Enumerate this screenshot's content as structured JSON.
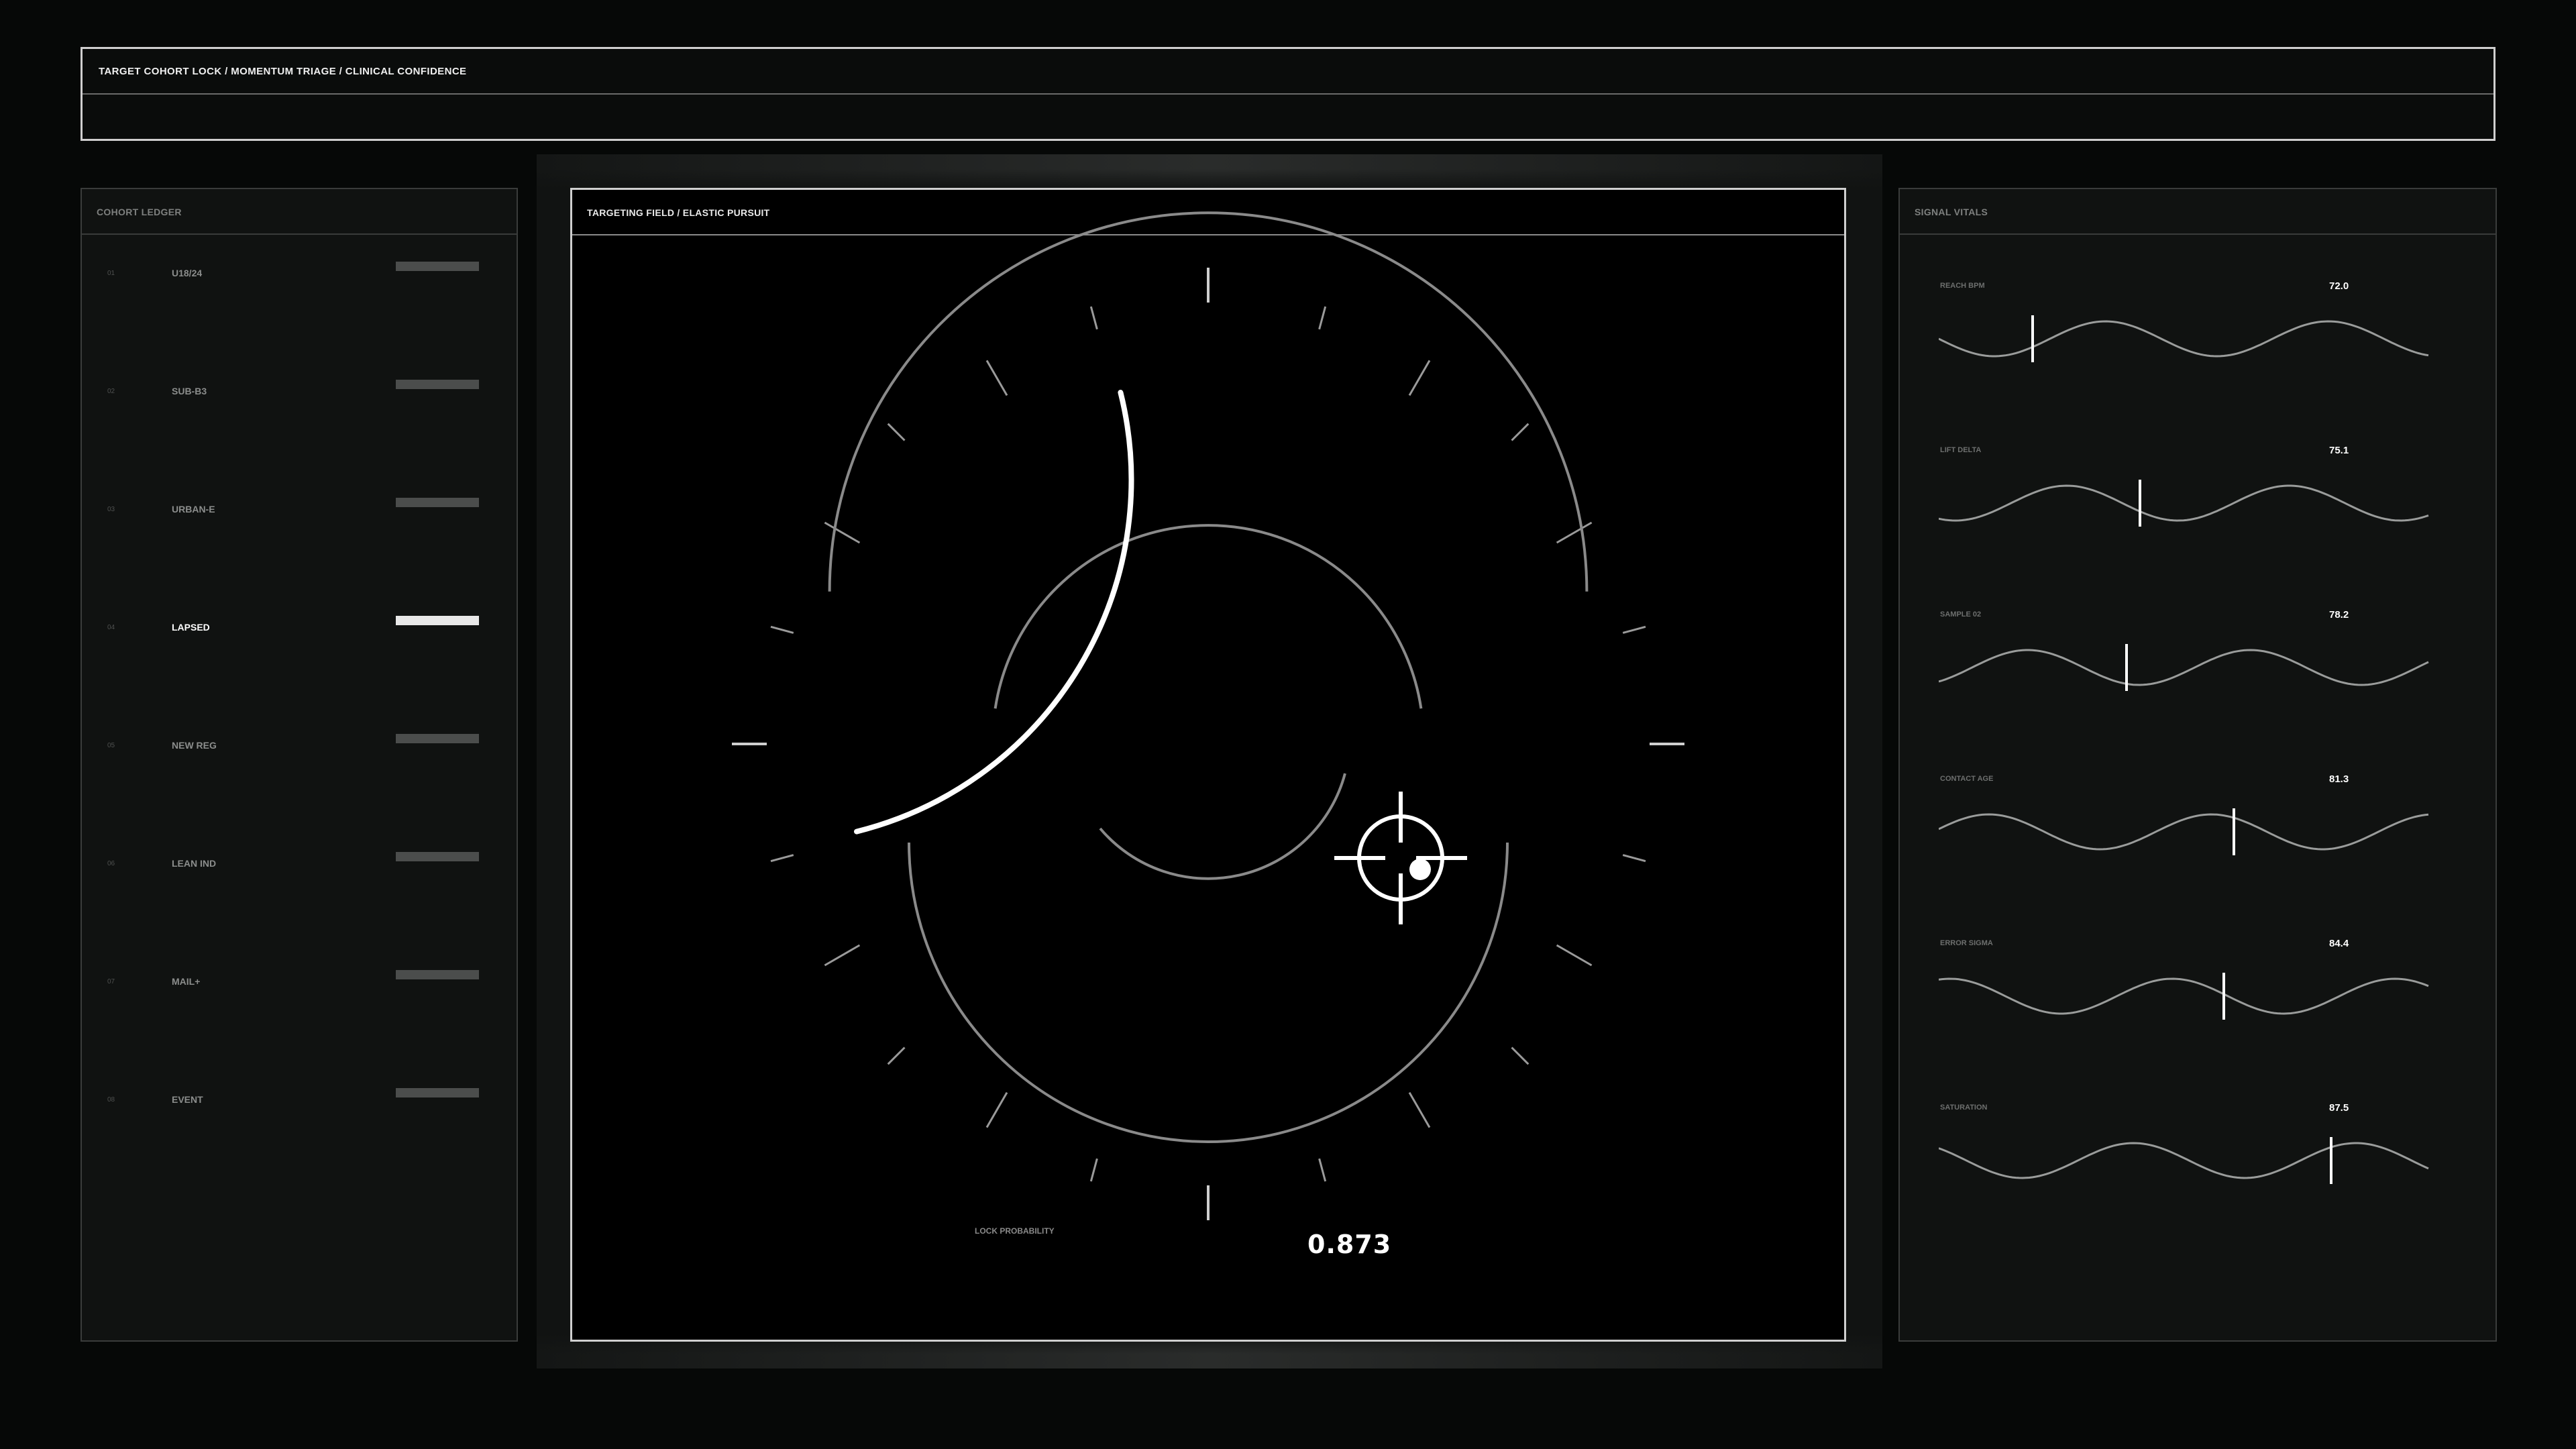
{
  "header": {
    "title": "TARGET COHORT LOCK / MOMENTUM TRIAGE / CLINICAL CONFIDENCE"
  },
  "ledger": {
    "title": "COHORT LEDGER",
    "active_index": 3,
    "rows": [
      {
        "idx": "01",
        "label": "U18/24"
      },
      {
        "idx": "02",
        "label": "SUB-B3"
      },
      {
        "idx": "03",
        "label": "URBAN-E"
      },
      {
        "idx": "04",
        "label": "LAPSED"
      },
      {
        "idx": "05",
        "label": "NEW REG"
      },
      {
        "idx": "06",
        "label": "LEAN IND"
      },
      {
        "idx": "07",
        "label": "MAIL+"
      },
      {
        "idx": "08",
        "label": "EVENT"
      }
    ]
  },
  "targeting": {
    "title": "TARGETING FIELD / ELASTIC PURSUIT",
    "lock_label": "LOCK PROBABILITY",
    "lock_value": "0.873",
    "lock_probability": 0.873
  },
  "vitals": {
    "title": "SIGNAL VITALS",
    "items": [
      {
        "label": "REACH BPM",
        "value": "72.0"
      },
      {
        "label": "LIFT DELTA",
        "value": "75.1"
      },
      {
        "label": "SAMPLE 02",
        "value": "78.2"
      },
      {
        "label": "CONTACT AGE",
        "value": "81.3"
      },
      {
        "label": "ERROR SIGMA",
        "value": "84.4"
      },
      {
        "label": "SATURATION",
        "value": "87.5"
      }
    ]
  },
  "colors": {
    "background": "#060807",
    "accent": "#ffffff",
    "muted": "#4b4d4c"
  }
}
